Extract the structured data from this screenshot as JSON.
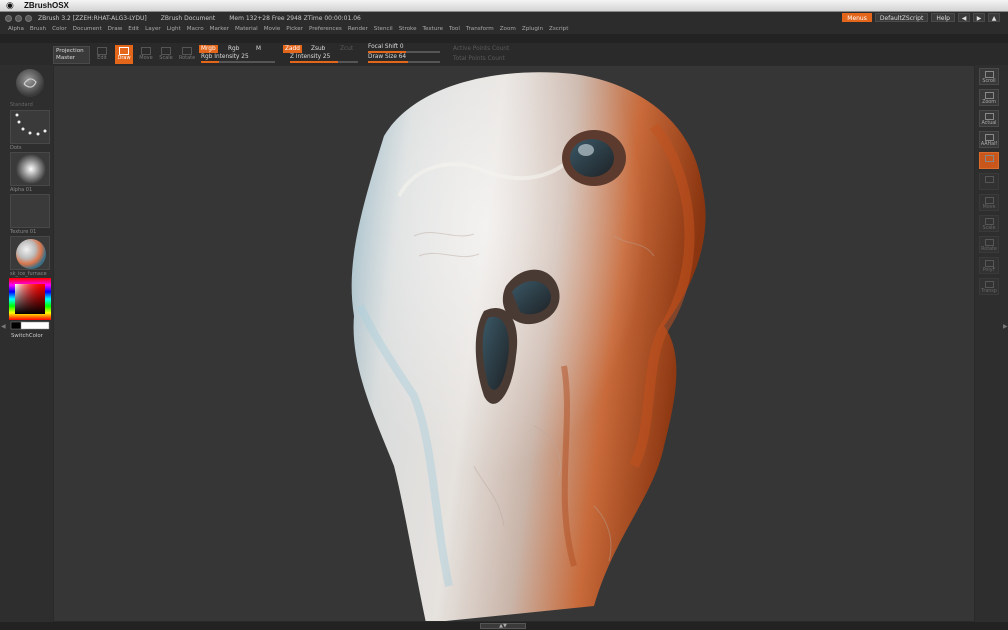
{
  "mac": {
    "app_name": "ZBrushOSX",
    "apple_glyph": ""
  },
  "title": {
    "app": "ZBrush 3.2 [ZZEH:RHAT-ALG3-LYDU]",
    "document": "ZBrush Document",
    "stats": "Mem 132+28  Free 2948  ZTime 00:00:01.06",
    "menus_btn": "Menus",
    "script_btn": "DefaultZScript",
    "help_btn": "Help"
  },
  "menu_items": [
    "Alpha",
    "Brush",
    "Color",
    "Document",
    "Draw",
    "Edit",
    "Layer",
    "Light",
    "Macro",
    "Marker",
    "Material",
    "Movie",
    "Picker",
    "Preferences",
    "Render",
    "Stencil",
    "Stroke",
    "Texture",
    "Tool",
    "Transform",
    "Zoom",
    "Zplugin",
    "Zscript"
  ],
  "shelf": {
    "projection_line1": "Projection",
    "projection_line2": "Master",
    "tools": [
      {
        "label": "Edit",
        "active": false
      },
      {
        "label": "Draw",
        "active": true
      },
      {
        "label": "Move",
        "active": false
      },
      {
        "label": "Scale",
        "active": false
      },
      {
        "label": "Rotate",
        "active": false
      }
    ],
    "mrgb": "Mrgb",
    "rgb": "Rgb",
    "m": "M",
    "zadd": "Zadd",
    "zsub": "Zsub",
    "zcut": "Zcut",
    "rgb_intensity": "Rgb Intensity 25",
    "z_intensity": "Z Intensity 25",
    "focal_shift": "Focal Shift 0",
    "draw_size": "Draw Size 64",
    "active_points": "Active Points Count",
    "total_points": "Total Points Count",
    "rgb_intensity_value": 25,
    "z_intensity_value": 25,
    "draw_size_value": 64
  },
  "left": {
    "brush_label": "Standard",
    "stroke_label": "Dots",
    "alpha_label": "Alpha 01",
    "texture_label": "Texture 01",
    "material_label": "sk_ice_furnace",
    "switch_color": "SwitchColor"
  },
  "right": [
    {
      "label": "Scroll",
      "state": "normal"
    },
    {
      "label": "Zoom",
      "state": "normal"
    },
    {
      "label": "Actual",
      "state": "normal"
    },
    {
      "label": "AAHalf",
      "state": "normal"
    },
    {
      "label": "",
      "state": "orange"
    },
    {
      "label": "",
      "state": "dim"
    },
    {
      "label": "Move",
      "state": "dim"
    },
    {
      "label": "Scale",
      "state": "dim"
    },
    {
      "label": "Rotate",
      "state": "dim"
    },
    {
      "label": "PolyF",
      "state": "dim"
    },
    {
      "label": "Transp",
      "state": "dim"
    }
  ],
  "colors": {
    "accent": "#e4661b",
    "panel": "#2e2e2e",
    "canvas": "#363636"
  }
}
